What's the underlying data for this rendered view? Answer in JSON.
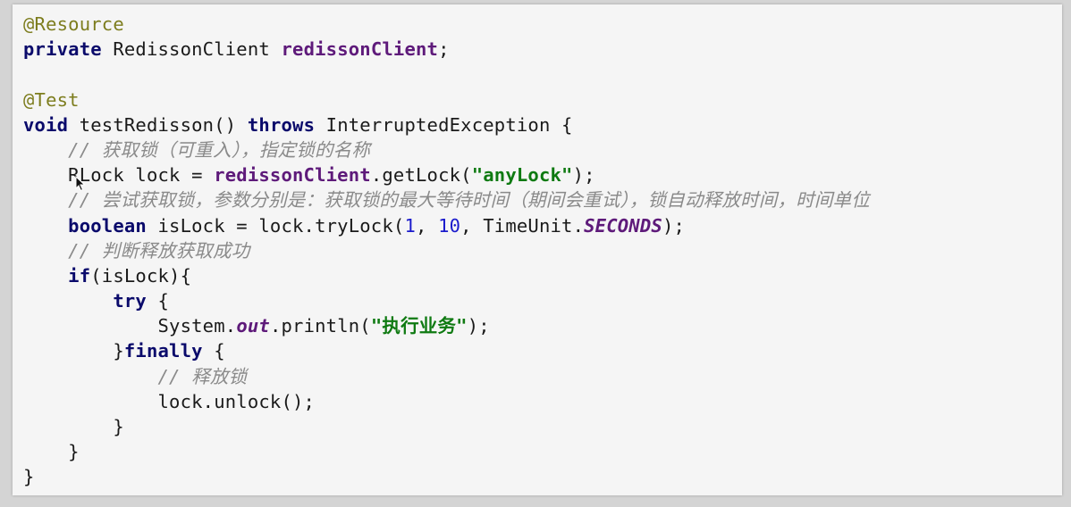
{
  "code": {
    "l1": {
      "annotation": "@Resource"
    },
    "l2": {
      "kw_private": "private",
      "type": " RedissonClient ",
      "field": "redissonClient",
      "end": ";"
    },
    "l3": {
      "blank": ""
    },
    "l4": {
      "annotation": "@Test"
    },
    "l5": {
      "kw_void": "void",
      "sig": " testRedisson() ",
      "kw_throws": "throws",
      "rest": " InterruptedException {"
    },
    "l6": {
      "indent": "    ",
      "comment": "// 获取锁（可重入），指定锁的名称"
    },
    "l7": {
      "indent": "    ",
      "pre": "RLock lock = ",
      "field": "redissonClient",
      "mid": ".getLock(",
      "str": "\"anyLock\"",
      "end": ");"
    },
    "l8": {
      "indent": "    ",
      "comment": "// 尝试获取锁，参数分别是：获取锁的最大等待时间（期间会重试），锁自动释放时间，时间单位"
    },
    "l9": {
      "indent": "    ",
      "kw_boolean": "boolean",
      "pre": " isLock = lock.tryLock(",
      "n1": "1",
      "sep": ", ",
      "n2": "10",
      "mid": ", TimeUnit.",
      "const": "SECONDS",
      "end": ");"
    },
    "l10": {
      "indent": "    ",
      "comment": "// 判断释放获取成功"
    },
    "l11": {
      "indent": "    ",
      "kw_if": "if",
      "rest": "(isLock){"
    },
    "l12": {
      "indent": "        ",
      "kw_try": "try",
      "rest": " {"
    },
    "l13": {
      "indent": "            ",
      "pre": "System.",
      "static": "out",
      "mid": ".println(",
      "str": "\"执行业务\"",
      "end": ");"
    },
    "l14": {
      "indent": "        ",
      "brace": "}",
      "kw_finally": "finally",
      "rest": " {"
    },
    "l15": {
      "indent": "            ",
      "comment": "// 释放锁"
    },
    "l16": {
      "indent": "            ",
      "text": "lock.unlock();"
    },
    "l17": {
      "indent": "        ",
      "text": "}"
    },
    "l18": {
      "indent": "    ",
      "text": "}"
    },
    "l19": {
      "indent": "",
      "text": "}"
    }
  },
  "colors": {
    "panel_background": "#f5f5f5",
    "keyword": "#0a0a6b",
    "annotation": "#7d7d1e",
    "field": "#5e1a7a",
    "string": "#0f7a12",
    "number": "#1a1acc",
    "comment": "#8a8a8a"
  },
  "icons": {
    "cursor": "mouse-pointer-icon"
  }
}
